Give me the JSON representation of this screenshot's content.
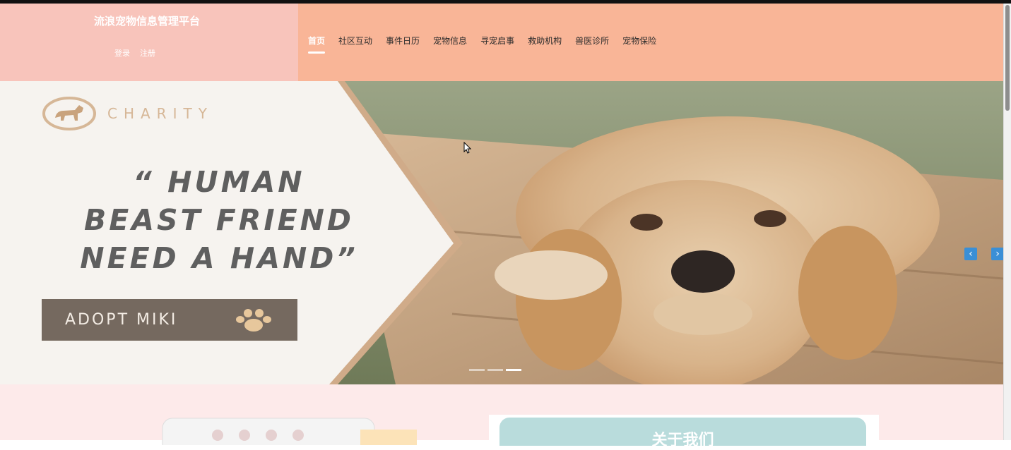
{
  "header": {
    "site_title": "流浪宠物信息管理平台",
    "login": "登录",
    "register": "注册",
    "nav": [
      {
        "label": "首页",
        "active": true
      },
      {
        "label": "社区互动"
      },
      {
        "label": "事件日历"
      },
      {
        "label": "宠物信息"
      },
      {
        "label": "寻宠启事"
      },
      {
        "label": "救助机构"
      },
      {
        "label": "兽医诊所"
      },
      {
        "label": "宠物保险"
      }
    ]
  },
  "banner": {
    "brand": "CHARITY",
    "quote_line1": "“ HUMAN",
    "quote_line2": "BEAST FRIEND",
    "quote_line3": "NEED A HAND”",
    "adopt_label": "ADOPT MIKI",
    "prev": "‹",
    "next": "›",
    "slide_count": 3,
    "active_slide": 3
  },
  "about": {
    "title": "关于我们"
  },
  "colors": {
    "header_left": "#f8c4bb",
    "header_right": "#f9b597",
    "accent_blue": "#3a8fd6",
    "about_head": "#b9dcdc",
    "lower_bg": "#fdeaea"
  }
}
